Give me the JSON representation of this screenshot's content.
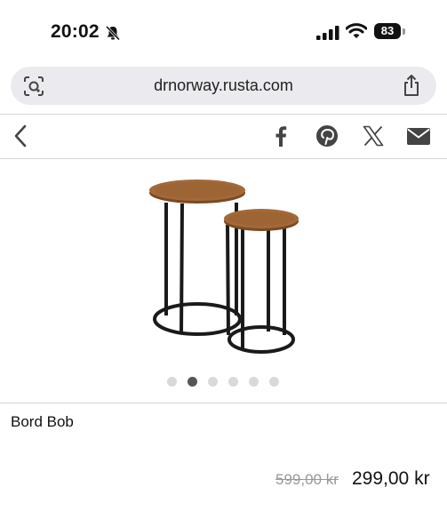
{
  "status_bar": {
    "time": "20:02",
    "battery": "83",
    "icons": [
      "bell-slash-icon",
      "signal-icon",
      "wifi-icon",
      "battery-icon"
    ]
  },
  "browser": {
    "url": "drnorway.rusta.com",
    "icons": [
      "lens-icon",
      "share-icon"
    ]
  },
  "toolbar": {
    "icons": [
      "back-chevron-icon",
      "facebook-icon",
      "pinterest-icon",
      "x-icon",
      "mail-icon"
    ]
  },
  "gallery": {
    "dot_count": 6,
    "active_index": 1
  },
  "product": {
    "title": "Bord Bob",
    "old_price": "599,00 kr",
    "price": "299,00 kr"
  },
  "colors": {
    "url_bar_bg": "#ebebef",
    "wood": "#9a6232",
    "metal": "#1a1a1a",
    "old_price": "#999999"
  }
}
